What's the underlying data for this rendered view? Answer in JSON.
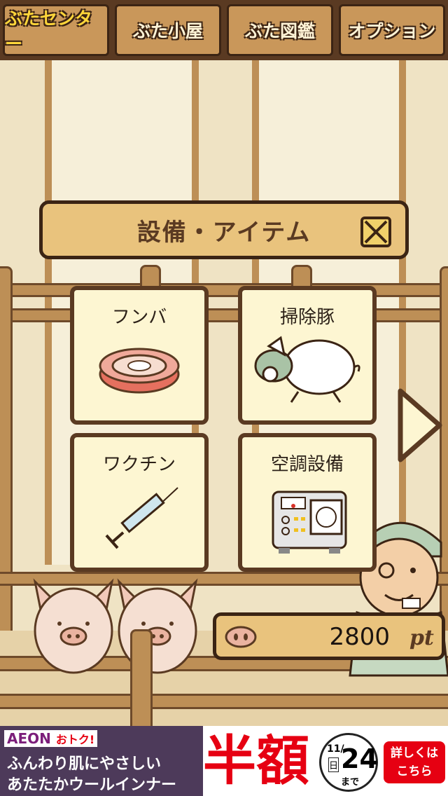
{
  "tabs": [
    {
      "label": "ぶたセンター",
      "active": true
    },
    {
      "label": "ぶた小屋",
      "active": false
    },
    {
      "label": "ぶた図鑑",
      "active": false
    },
    {
      "label": "オプション",
      "active": false
    }
  ],
  "dialog": {
    "title": "設備・アイテム"
  },
  "items": [
    {
      "label": "フンバ",
      "icon": "roomba-icon"
    },
    {
      "label": "掃除豚",
      "icon": "cleaning-pig-icon"
    },
    {
      "label": "ワクチン",
      "icon": "syringe-icon"
    },
    {
      "label": "空調設備",
      "icon": "air-conditioner-icon"
    }
  ],
  "points": {
    "value": "2800",
    "unit": "pt",
    "icon": "pig-nose-icon"
  },
  "ad": {
    "brand": "AEON",
    "brand_sub": "おトク!",
    "line1": "ふんわり肌にやさしい",
    "line2": "あたたかウールインナー",
    "headline": "半額",
    "date_month_day": "11/",
    "date_day": "24",
    "date_weekday": "日",
    "date_suffix": "まで",
    "cta_line1": "詳しくは",
    "cta_line2": "こちら"
  },
  "colors": {
    "wood": "#e9c37d",
    "dark_wood": "#3b2414",
    "card_bg": "#fdf6d2",
    "active_tab_text": "#ffd63a",
    "ad_headline": "#e60012"
  }
}
